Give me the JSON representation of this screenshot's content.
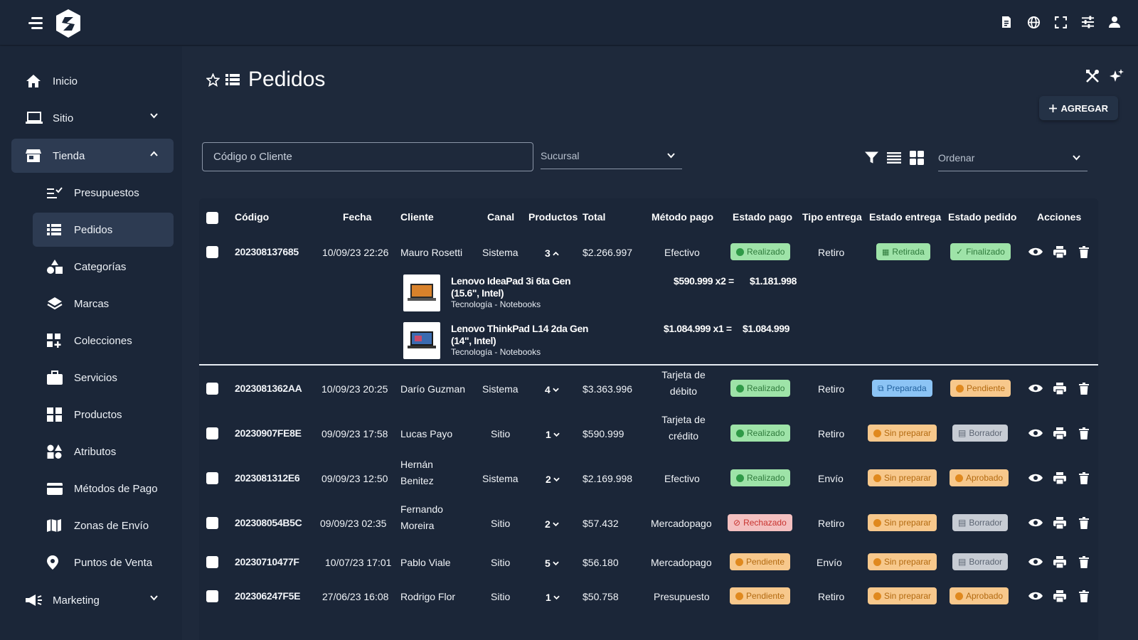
{
  "sidebar": {
    "items": [
      {
        "label": "Inicio",
        "icon": "home-icon"
      },
      {
        "label": "Sitio",
        "icon": "laptop-icon"
      },
      {
        "label": "Tienda",
        "icon": "store-icon"
      },
      {
        "label": "Marketing",
        "icon": "megaphone-icon"
      }
    ],
    "tienda_sub": [
      {
        "label": "Presupuestos",
        "icon": "checklist-icon"
      },
      {
        "label": "Pedidos",
        "icon": "list-icon"
      },
      {
        "label": "Categorías",
        "icon": "shapes-icon"
      },
      {
        "label": "Marcas",
        "icon": "layers-icon"
      },
      {
        "label": "Colecciones",
        "icon": "grid-plus-icon"
      },
      {
        "label": "Servicios",
        "icon": "briefcase-icon"
      },
      {
        "label": "Productos",
        "icon": "boxes-icon"
      },
      {
        "label": "Atributos",
        "icon": "shapes-grid-icon"
      },
      {
        "label": "Métodos de Pago",
        "icon": "credit-card-icon"
      },
      {
        "label": "Zonas de Envío",
        "icon": "map-icon"
      },
      {
        "label": "Puntos de Venta",
        "icon": "pin-icon"
      }
    ]
  },
  "header": {
    "title": "Pedidos",
    "add_label": "AGREGAR"
  },
  "filters": {
    "search_placeholder": "Código o Cliente",
    "branch_label": "Sucursal",
    "sort_label": "Ordenar"
  },
  "table": {
    "columns": [
      "Código",
      "Fecha",
      "Cliente",
      "Canal",
      "Productos",
      "Total",
      "Método pago",
      "Estado pago",
      "Tipo entrega",
      "Estado entrega",
      "Estado pedido",
      "Acciones"
    ],
    "rows": [
      {
        "code": "202308137685",
        "date": "10/09/23 22:26",
        "client": "Mauro Rosetti",
        "channel": "Sistema",
        "products": "3",
        "expanded": true,
        "total": "$2.266.997",
        "payment": "Efectivo",
        "pay_status": "Realizado",
        "delivery_type": "Retiro",
        "delivery_status": "Retirada",
        "order_status": "Finalizado"
      },
      {
        "code": "2023081362AA",
        "date": "10/09/23 20:25",
        "client": "Darío Guzman",
        "channel": "Sistema",
        "products": "4",
        "expanded": false,
        "total": "$3.363.996",
        "payment": "Tarjeta de débito",
        "pay_status": "Realizado",
        "delivery_type": "Retiro",
        "delivery_status": "Preparada",
        "order_status": "Pendiente"
      },
      {
        "code": "20230907FE8E",
        "date": "09/09/23 17:58",
        "client": "Lucas Payo",
        "channel": "Sitio",
        "products": "1",
        "expanded": false,
        "total": "$590.999",
        "payment": "Tarjeta de crédito",
        "pay_status": "Realizado",
        "delivery_type": "Retiro",
        "delivery_status": "Sin preparar",
        "order_status": "Borrador"
      },
      {
        "code": "2023081312E6",
        "date": "09/09/23 12:50",
        "client": "Hernán Benitez",
        "channel": "Sistema",
        "products": "2",
        "expanded": false,
        "total": "$2.169.998",
        "payment": "Efectivo",
        "pay_status": "Realizado",
        "delivery_type": "Envío",
        "delivery_status": "Sin preparar",
        "order_status": "Aprobado"
      },
      {
        "code": "202308054B5C",
        "date": "09/09/23 02:35",
        "client": "Fernando Moreira",
        "channel": "Sitio",
        "products": "2",
        "expanded": false,
        "total": "$57.432",
        "payment": "Mercadopago",
        "pay_status": "Rechazado",
        "delivery_type": "Retiro",
        "delivery_status": "Sin preparar",
        "order_status": "Borrador"
      },
      {
        "code": "20230710477F",
        "date": "10/07/23 17:01",
        "client": "Pablo Viale",
        "channel": "Sitio",
        "products": "5",
        "expanded": false,
        "total": "$56.180",
        "payment": "Mercadopago",
        "pay_status": "Pendiente",
        "delivery_type": "Envío",
        "delivery_status": "Sin preparar",
        "order_status": "Borrador"
      },
      {
        "code": "202306247F5E",
        "date": "27/06/23 16:08",
        "client": "Rodrigo Flor",
        "channel": "Sitio",
        "products": "1",
        "expanded": false,
        "total": "$50.758",
        "payment": "Presupuesto",
        "pay_status": "Pendiente",
        "delivery_type": "Retiro",
        "delivery_status": "Sin preparar",
        "order_status": "Aprobado"
      }
    ],
    "expanded_products": [
      {
        "name": "Lenovo IdeaPad 3i 6ta Gen (15.6\", Intel)",
        "category": "Tecnología - Notebooks",
        "price": "$590.999 x2 =",
        "subtotal": "$1.181.998"
      },
      {
        "name": "Lenovo ThinkPad L14 2da Gen (14\", Intel)",
        "category": "Tecnología - Notebooks",
        "price": "$1.084.999 x1 =",
        "subtotal": "$1.084.999"
      }
    ]
  },
  "colors": {
    "background": "#1b2638",
    "main": "#1e293b",
    "active": "#2d3b52",
    "green_badge": "#9ee3a8",
    "orange_badge": "#f7c88c",
    "blue_badge": "#8cc4f5",
    "grey_badge": "#c7ccd4",
    "red_badge": "#f4c0c0"
  }
}
